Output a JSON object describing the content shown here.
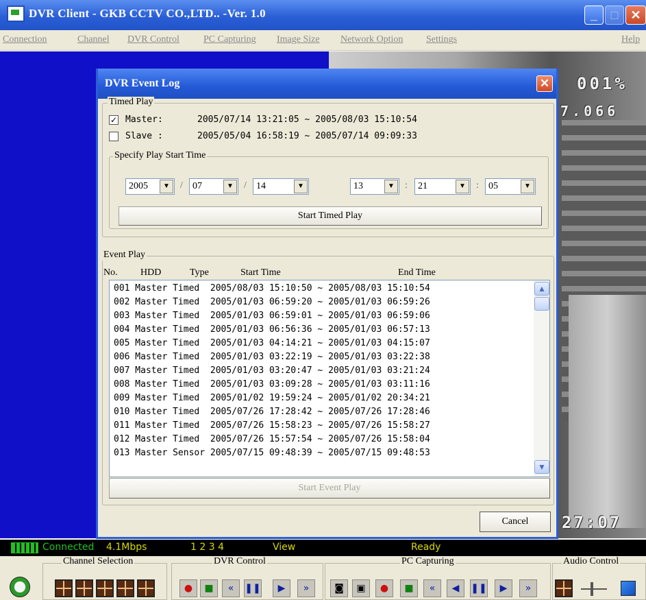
{
  "window": {
    "title": "DVR Client - GKB CCTV CO.,LTD..  -Ver. 1.0",
    "min_glyph": "_",
    "max_glyph": "□",
    "close_glyph": "✕"
  },
  "menu": [
    "Connection",
    "Channel",
    "DVR Control",
    "PC Capturing",
    "Image Size",
    "Network Option",
    "Settings",
    "Help"
  ],
  "video": {
    "osd_top": "001%",
    "osd_mid": "7.066",
    "osd_time": "27:07"
  },
  "dialog": {
    "title": "DVR Event Log",
    "close_glyph": "✕",
    "timed_play": {
      "legend": "Timed Play",
      "master": {
        "checked": true,
        "label": "Master:",
        "range": "2005/07/14 13:21:05 ~ 2005/08/03 15:10:54"
      },
      "slave": {
        "checked": false,
        "label": "Slave :",
        "range": "2005/05/04 16:58:19 ~ 2005/07/14 09:09:33"
      },
      "specify_legend": "Specify Play Start Time",
      "year": "2005",
      "month": "07",
      "day": "14",
      "hour": "13",
      "minute": "21",
      "second": "05",
      "date_sep": "/",
      "time_sep": ":",
      "start_button": "Start Timed Play"
    },
    "event_play": {
      "legend": "Event Play",
      "headers": {
        "no": "No.",
        "hdd": "HDD",
        "type": "Type",
        "start": "Start Time",
        "end": "End Time"
      },
      "rows": [
        "001 Master Timed  2005/08/03 15:10:50 ~ 2005/08/03 15:10:54",
        "002 Master Timed  2005/01/03 06:59:20 ~ 2005/01/03 06:59:26",
        "003 Master Timed  2005/01/03 06:59:01 ~ 2005/01/03 06:59:06",
        "004 Master Timed  2005/01/03 06:56:36 ~ 2005/01/03 06:57:13",
        "005 Master Timed  2005/01/03 04:14:21 ~ 2005/01/03 04:15:07",
        "006 Master Timed  2005/01/03 03:22:19 ~ 2005/01/03 03:22:38",
        "007 Master Timed  2005/01/03 03:20:47 ~ 2005/01/03 03:21:24",
        "008 Master Timed  2005/01/03 03:09:28 ~ 2005/01/03 03:11:16",
        "009 Master Timed  2005/01/02 19:59:24 ~ 2005/01/02 20:34:21",
        "010 Master Timed  2005/07/26 17:28:42 ~ 2005/07/26 17:28:46",
        "011 Master Timed  2005/07/26 15:58:23 ~ 2005/07/26 15:58:27",
        "012 Master Timed  2005/07/26 15:57:54 ~ 2005/07/26 15:58:04",
        "013 Master Sensor 2005/07/15 09:48:39 ~ 2005/07/15 09:48:53"
      ],
      "start_button": "Start Event Play"
    },
    "cancel_button": "Cancel"
  },
  "status": {
    "connection": "Connected",
    "bitrate": "4.1Mbps",
    "channels": "1 2 3 4",
    "mode": "View",
    "state": "Ready"
  },
  "toolbar": {
    "channel_selection": "Channel Selection",
    "dvr_control": "DVR Control",
    "pc_capturing": "PC Capturing",
    "audio_control": "Audio Control"
  },
  "colors": {
    "titlebar": "#2a5fd6",
    "video_blue": "#1010c8",
    "status_green": "#20c020",
    "status_yellow": "#d8d800",
    "record_red": "#cc1010",
    "stop_green": "#108010",
    "play_blue": "#1020a0"
  }
}
